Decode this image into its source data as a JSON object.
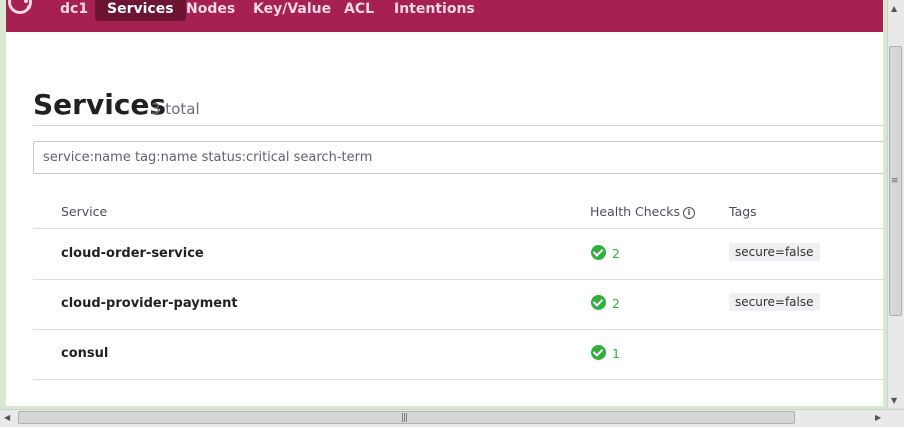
{
  "nav": {
    "datacenter": "dc1",
    "items": [
      "Services",
      "Nodes",
      "Key/Value",
      "ACL",
      "Intentions"
    ],
    "active": "Services"
  },
  "page": {
    "title": "Services",
    "subtitle": "3 total"
  },
  "search": {
    "placeholder": "service:name tag:name status:critical search-term",
    "value": ""
  },
  "table": {
    "headers": {
      "service": "Service",
      "health": "Health Checks",
      "tags": "Tags"
    },
    "rows": [
      {
        "name": "cloud-order-service",
        "checks": "2",
        "status": "passing",
        "tag": "secure=false"
      },
      {
        "name": "cloud-provider-payment",
        "checks": "2",
        "status": "passing",
        "tag": "secure=false"
      },
      {
        "name": "consul",
        "checks": "1",
        "status": "passing",
        "tag": ""
      }
    ]
  },
  "icons": {
    "logo": "consul-logo-icon",
    "info": "info-icon",
    "check": "check-circle-icon"
  },
  "colors": {
    "nav_bg": "#a62052",
    "nav_active_bg": "#6b1533",
    "passing": "#2eb039",
    "window_frame": "#d8e9d2"
  }
}
